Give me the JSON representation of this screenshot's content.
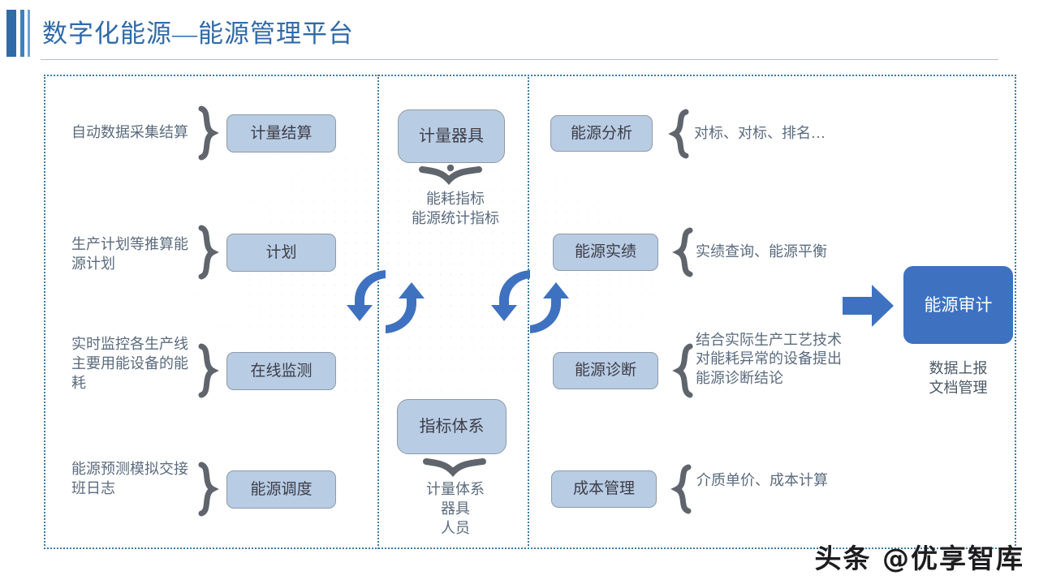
{
  "slide": {
    "title": "数字化能源—能源管理平台",
    "watermark": "头条 @优享智库",
    "accent_blue": "#3e72c0",
    "pill_blue": "#b8cce4",
    "title_blue": "#2f6aa8",
    "dotted_border": "#3c7ca6"
  },
  "left_column": {
    "rows": [
      {
        "desc": "自动数据采集结算",
        "box": "计量结算",
        "brace": "right-brace-icon"
      },
      {
        "desc": "生产计划等推算能\n源计划",
        "box": "计划",
        "brace": "right-brace-icon"
      },
      {
        "desc": "实时监控各生产线\n主要用能设备的能\n耗",
        "box": "在线监测",
        "brace": "right-brace-icon"
      },
      {
        "desc": "能源预测模拟交接\n班日志",
        "box": "能源调度",
        "brace": "right-brace-icon"
      }
    ]
  },
  "middle_column": {
    "groups": [
      {
        "box": "计量器具",
        "brace": "down-brace-icon",
        "desc": "能耗指标\n能源统计指标"
      },
      {
        "box": "指标体系",
        "brace": "down-brace-icon",
        "desc": "计量体系\n器具\n人员"
      }
    ],
    "cycle_icons": [
      "cycle-arrows-icon",
      "cycle-arrows-icon"
    ]
  },
  "right_column": {
    "rows": [
      {
        "box": "能源分析",
        "brace": "left-brace-icon",
        "desc": "对标、对标、排名…"
      },
      {
        "box": "能源实绩",
        "brace": "left-brace-icon",
        "desc": "实绩查询、能源平衡"
      },
      {
        "box": "能源诊断",
        "brace": "left-brace-icon",
        "desc": "结合实际生产工艺技术\n对能耗异常的设备提出\n能源诊断结论"
      },
      {
        "box": "成本管理",
        "brace": "left-brace-icon",
        "desc": "介质单价、成本计算"
      }
    ]
  },
  "audit_panel": {
    "arrow": "right-arrow-icon",
    "box": "能源审计",
    "desc": "数据上报\n文档管理"
  }
}
